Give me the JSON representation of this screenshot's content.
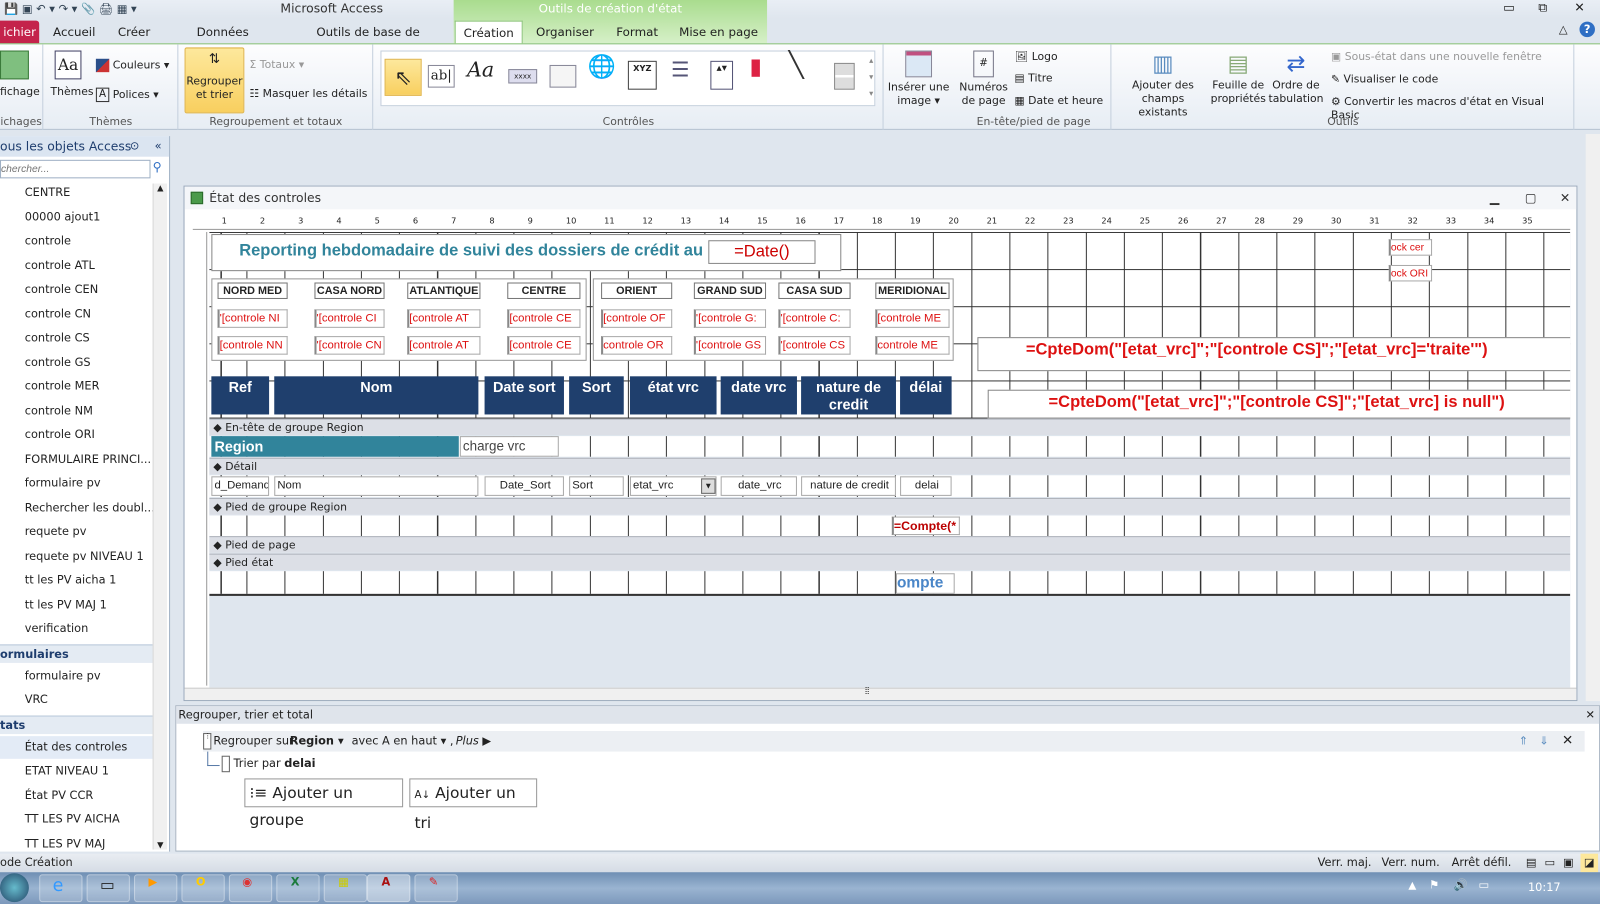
{
  "app": {
    "title": "Microsoft Access",
    "context_tab": "Outils de création d'état"
  },
  "tabs": [
    "ichier",
    "Accueil",
    "Créer",
    "Données externes",
    "Outils de base de données",
    "Création",
    "Organiser",
    "Format",
    "Mise en page"
  ],
  "ribbon": {
    "affichage": {
      "label": "fichage",
      "group": "ichages"
    },
    "themes": {
      "themes": "Thèmes",
      "couleurs": "Couleurs",
      "polices": "Polices",
      "group": "Thèmes"
    },
    "regroupement": {
      "regrouper": "Regrouper",
      "et_trier": "et trier",
      "totaux": "Totaux",
      "masquer": "Masquer les détails",
      "group": "Regroupement et totaux"
    },
    "controles": {
      "group": "Contrôles",
      "textbox": "ab|",
      "label": "Aa",
      "button": "xxxx",
      "group_box": "XYZ"
    },
    "inserer": {
      "l1": "Insérer une",
      "l2": "image"
    },
    "entete": {
      "numeros1": "Numéros",
      "numeros2": "de page",
      "logo": "Logo",
      "titre": "Titre",
      "date": "Date et heure",
      "group": "En-tête/pied de page"
    },
    "outils": {
      "ajouter1": "Ajouter des",
      "ajouter2": "champs existants",
      "feuille1": "Feuille de",
      "feuille2": "propriétés",
      "ordre1": "Ordre de",
      "ordre2": "tabulation",
      "sousetat": "Sous-état dans une nouvelle fenêtre",
      "code": "Visualiser le code",
      "convertir": "Convertir les macros d'état en Visual Basic",
      "group": "Outils"
    }
  },
  "nav": {
    "header": "ous les objets Access",
    "search_placeholder": "chercher...",
    "items": [
      "CENTRE",
      "00000 ajout1",
      "controle",
      "controle ATL",
      "controle CEN",
      "controle CN",
      "controle CS",
      "controle GS",
      "controle MER",
      "controle NM",
      "controle ORI",
      "FORMULAIRE PRINCI...",
      "formulaire pv",
      "Rechercher les doubl...",
      "requete  pv",
      "requete  pv NIVEAU 1",
      "tt les PV aicha 1",
      "tt les PV MAJ 1",
      "verification"
    ],
    "cat_formulaires": "ormulaires",
    "formulaires": [
      "formulaire pv",
      "VRC"
    ],
    "cat_etats": "tats",
    "etats": [
      "État des controles",
      "ETAT NIVEAU 1",
      "État PV CCR",
      "TT LES PV AICHA",
      "TT LES PV MAJ"
    ]
  },
  "report": {
    "window_title": "État des controles",
    "title": "Reporting hebdomadaire de suivi des dossiers de crédit au :",
    "date_expr": "=Date()",
    "regions": [
      "NORD MED",
      "CASA NORD",
      "ATLANTIQUE",
      "CENTRE",
      "ORIENT",
      "GRAND SUD",
      "CASA SUD",
      "MERIDIONAL"
    ],
    "fields_row1": [
      "'[controle NI",
      "'[controle CI",
      "[controle AT",
      "[controle CE",
      "[controle OF",
      "'[controle G:",
      "'[controle C:",
      "[controle ME"
    ],
    "fields_row2": [
      "[controle NN",
      "'[controle CN",
      "[controle AT",
      "[controle CE",
      "controle OR",
      "'[controle GS",
      "'[controle CS",
      "controle ME"
    ],
    "small1": "ock cer",
    "small2": "ock ORI",
    "formula1": "=CpteDom(\"[etat_vrc]\";\"[controle CS]\";\"[etat_vrc]='traite'\")",
    "formula2": "=CpteDom(\"[etat_vrc]\";\"[controle CS]\";\"[etat_vrc] is null\")",
    "headers": [
      "Ref",
      "Nom",
      "Date sort",
      "Sort",
      "état vrc",
      "date vrc",
      "nature de credit",
      "délai"
    ],
    "sections": {
      "group_header": "En-tête de groupe Region",
      "detail": "Détail",
      "group_footer": "Pied de groupe Region",
      "page_footer": "Pied de page",
      "report_footer": "Pied état"
    },
    "region_label": "Region",
    "charge": "charge vrc",
    "detail_fields": [
      "d_Demand",
      "Nom",
      "Date_Sort",
      "Sort",
      "etat_vrc",
      "date_vrc",
      "nature de credit",
      "delai"
    ],
    "count1": "=Compte(*",
    "count2": "ompte",
    "colors": {
      "header_bg": "#1f3f6d",
      "region_bg": "#31849b",
      "title": "#31849b",
      "expr": "#dd1111"
    }
  },
  "grouping": {
    "title": "Regrouper, trier et total",
    "group_on": "Regrouper sur",
    "group_field": "Region",
    "order": "avec A en haut",
    "more": "Plus",
    "sort_by": "Trier par",
    "sort_field": "delai",
    "add_group": "Ajouter un groupe",
    "add_sort": "Ajouter un tri"
  },
  "status": {
    "mode": "ode Création",
    "caps": "Verr. maj.",
    "num": "Verr. num.",
    "scroll": "Arrêt défil."
  },
  "taskbar": {
    "time": "10:17"
  }
}
